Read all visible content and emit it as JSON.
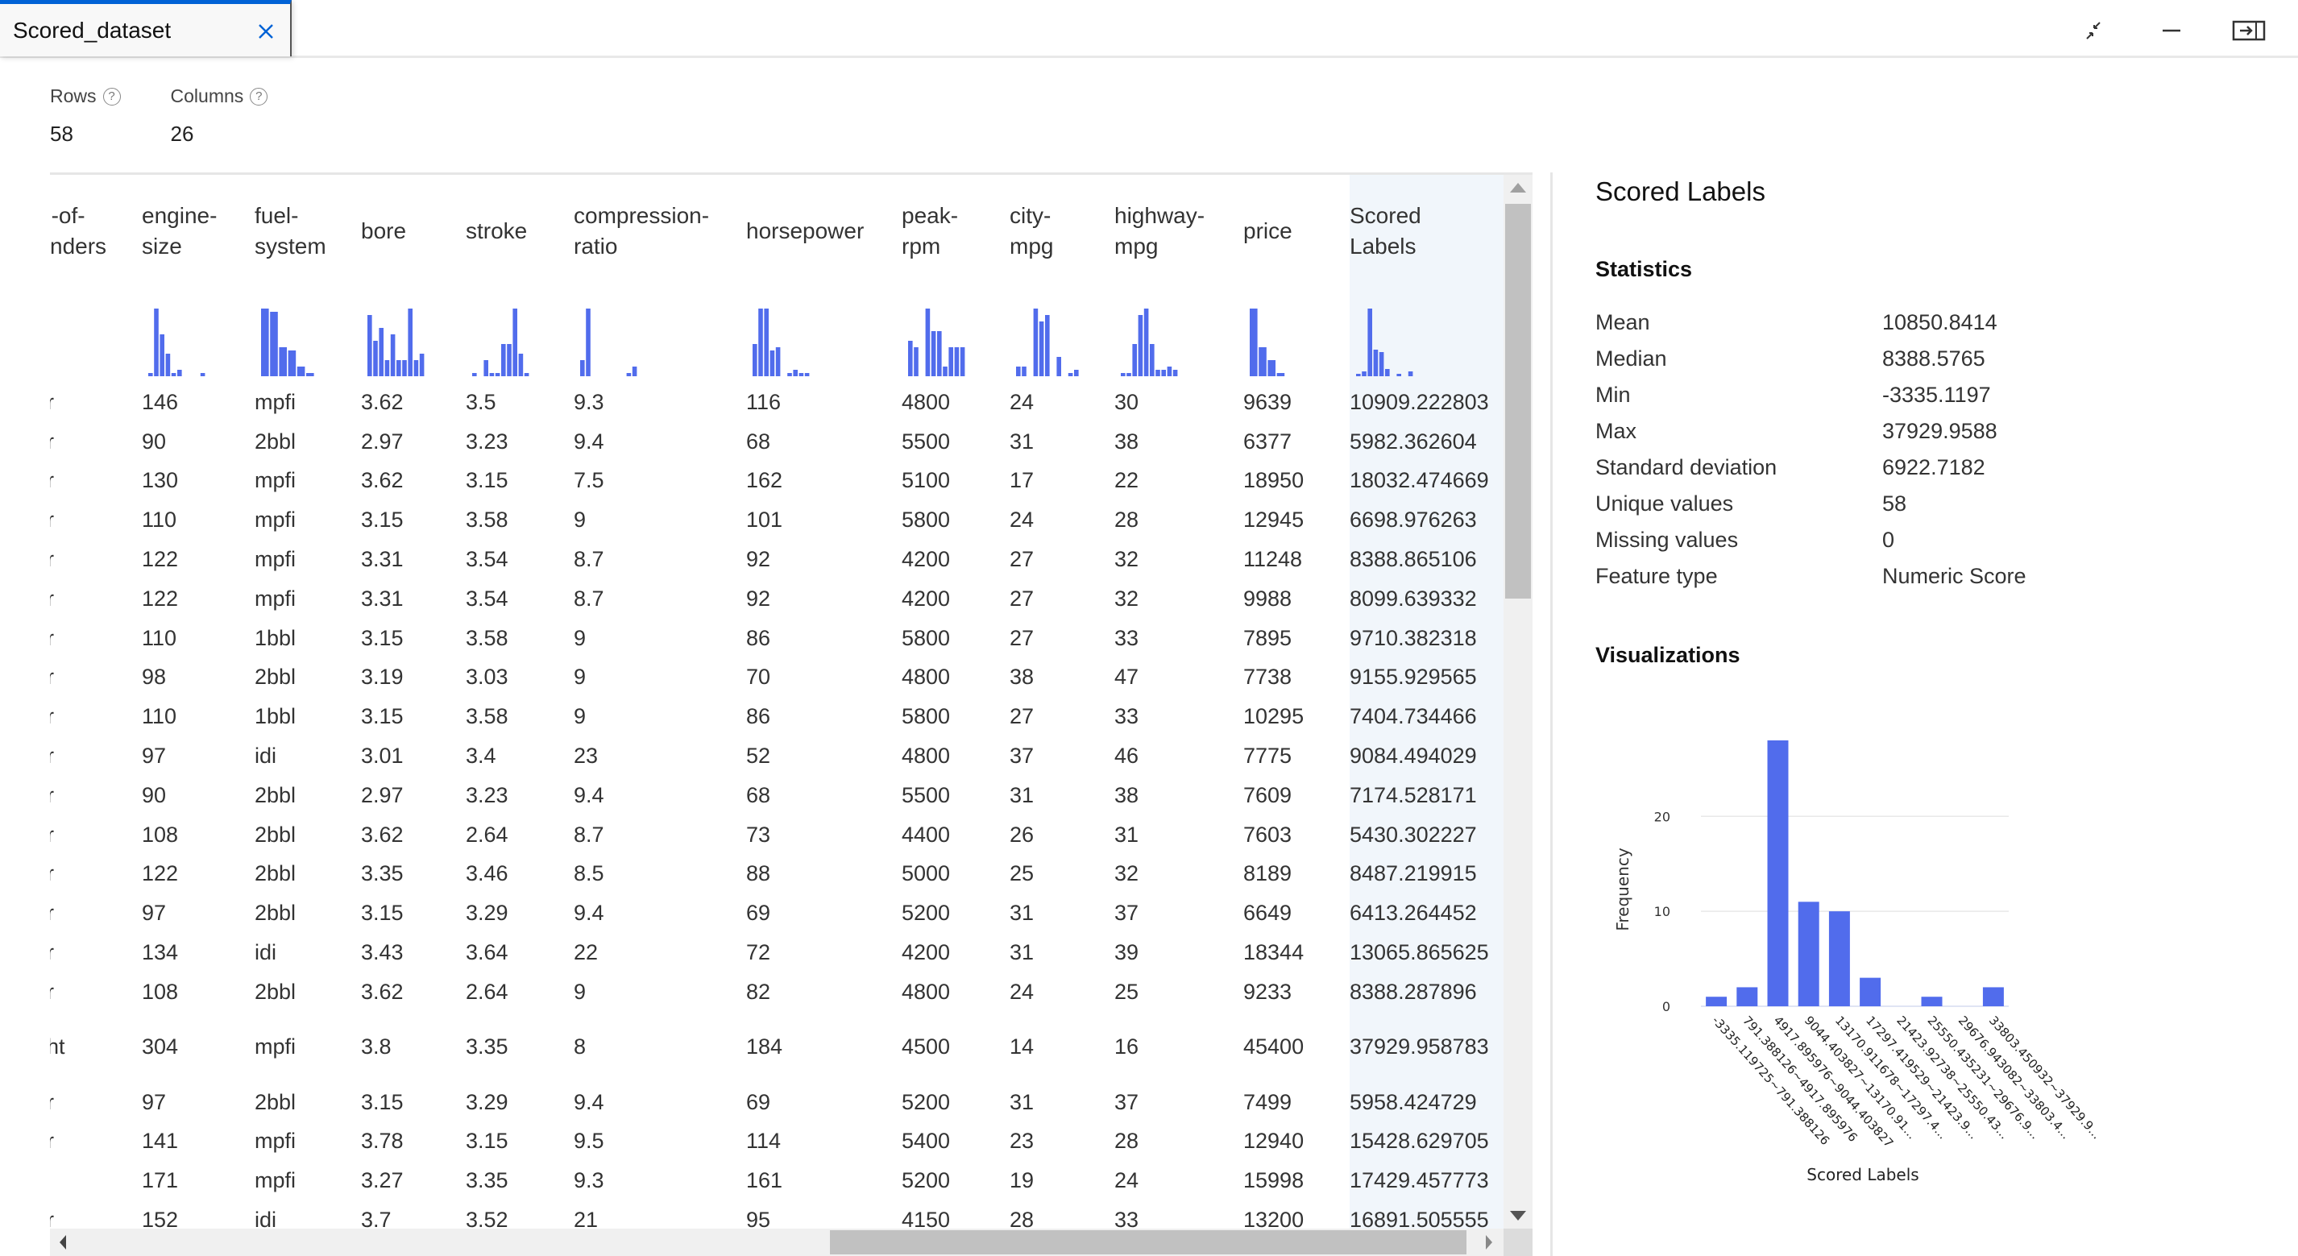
{
  "tab": {
    "title": "Scored_dataset",
    "close_icon": "close-icon"
  },
  "window_controls": [
    {
      "name": "collapse-icon"
    },
    {
      "name": "minimize-icon"
    },
    {
      "name": "dock-panel-icon"
    }
  ],
  "summary": {
    "rows_label": "Rows",
    "rows_value": "58",
    "columns_label": "Columns",
    "columns_value": "26",
    "help_glyph": "?"
  },
  "table": {
    "columns": [
      {
        "key": "cyl",
        "label": "n-of-\nnders",
        "partial": true
      },
      {
        "key": "engine_size",
        "label": "engine-\nsize"
      },
      {
        "key": "fuel_system",
        "label": "fuel-\nsystem"
      },
      {
        "key": "bore",
        "label": "bore"
      },
      {
        "key": "stroke",
        "label": "stroke"
      },
      {
        "key": "compression_ratio",
        "label": "compression-\nratio"
      },
      {
        "key": "horsepower",
        "label": "horsepower"
      },
      {
        "key": "peak_rpm",
        "label": "peak-\nrpm"
      },
      {
        "key": "city_mpg",
        "label": "city-\nmpg"
      },
      {
        "key": "highway_mpg",
        "label": "highway-\nmpg"
      },
      {
        "key": "price",
        "label": "price"
      },
      {
        "key": "scored_labels",
        "label": "Scored\nLabels",
        "selected": true
      }
    ],
    "column_histograms": {
      "cyl": [],
      "engine_size": [
        1,
        21,
        13,
        7,
        1,
        2,
        0,
        0,
        0,
        1
      ],
      "fuel_system": [
        21,
        20,
        9,
        8,
        3,
        1
      ],
      "bore": [
        19,
        11,
        15,
        5,
        13,
        5,
        5,
        21,
        5,
        7
      ],
      "stroke": [
        1,
        0,
        5,
        1,
        1,
        10,
        10,
        21,
        7,
        1
      ],
      "compression_ratio": [
        5,
        21,
        0,
        0,
        0,
        0,
        0,
        0,
        1,
        3
      ],
      "horsepower": [
        10,
        21,
        21,
        8,
        9,
        0,
        1,
        2,
        1,
        1
      ],
      "peak_rpm": [
        11,
        9,
        0,
        21,
        14,
        14,
        3,
        9,
        9,
        9
      ],
      "city_mpg": [
        3,
        3,
        0,
        21,
        17,
        19,
        0,
        6,
        0,
        1,
        2
      ],
      "highway_mpg": [
        1,
        1,
        10,
        19,
        21,
        10,
        2,
        2,
        3,
        2
      ],
      "price": [
        21,
        9,
        5,
        1
      ],
      "scored_labels": [
        1,
        2,
        28,
        11,
        10,
        3,
        0,
        1,
        0,
        2
      ]
    },
    "rows": [
      [
        "r",
        "146",
        "mpfi",
        "3.62",
        "3.5",
        "9.3",
        "116",
        "4800",
        "24",
        "30",
        "9639",
        "10909.222803"
      ],
      [
        "r",
        "90",
        "2bbl",
        "2.97",
        "3.23",
        "9.4",
        "68",
        "5500",
        "31",
        "38",
        "6377",
        "5982.362604"
      ],
      [
        "r",
        "130",
        "mpfi",
        "3.62",
        "3.15",
        "7.5",
        "162",
        "5100",
        "17",
        "22",
        "18950",
        "18032.474669"
      ],
      [
        "r",
        "110",
        "mpfi",
        "3.15",
        "3.58",
        "9",
        "101",
        "5800",
        "24",
        "28",
        "12945",
        "6698.976263"
      ],
      [
        "r",
        "122",
        "mpfi",
        "3.31",
        "3.54",
        "8.7",
        "92",
        "4200",
        "27",
        "32",
        "11248",
        "8388.865106"
      ],
      [
        "r",
        "122",
        "mpfi",
        "3.31",
        "3.54",
        "8.7",
        "92",
        "4200",
        "27",
        "32",
        "9988",
        "8099.639332"
      ],
      [
        "r",
        "110",
        "1bbl",
        "3.15",
        "3.58",
        "9",
        "86",
        "5800",
        "27",
        "33",
        "7895",
        "9710.382318"
      ],
      [
        "r",
        "98",
        "2bbl",
        "3.19",
        "3.03",
        "9",
        "70",
        "4800",
        "38",
        "47",
        "7738",
        "9155.929565"
      ],
      [
        "r",
        "110",
        "1bbl",
        "3.15",
        "3.58",
        "9",
        "86",
        "5800",
        "27",
        "33",
        "10295",
        "7404.734466"
      ],
      [
        "r",
        "97",
        "idi",
        "3.01",
        "3.4",
        "23",
        "52",
        "4800",
        "37",
        "46",
        "7775",
        "9084.494029"
      ],
      [
        "r",
        "90",
        "2bbl",
        "2.97",
        "3.23",
        "9.4",
        "68",
        "5500",
        "31",
        "38",
        "7609",
        "7174.528171"
      ],
      [
        "r",
        "108",
        "2bbl",
        "3.62",
        "2.64",
        "8.7",
        "73",
        "4400",
        "26",
        "31",
        "7603",
        "5430.302227"
      ],
      [
        "r",
        "122",
        "2bbl",
        "3.35",
        "3.46",
        "8.5",
        "88",
        "5000",
        "25",
        "32",
        "8189",
        "8487.219915"
      ],
      [
        "r",
        "97",
        "2bbl",
        "3.15",
        "3.29",
        "9.4",
        "69",
        "5200",
        "31",
        "37",
        "6649",
        "6413.264452"
      ],
      [
        "r",
        "134",
        "idi",
        "3.43",
        "3.64",
        "22",
        "72",
        "4200",
        "31",
        "39",
        "18344",
        "13065.865625"
      ],
      [
        "r",
        "108",
        "2bbl",
        "3.62",
        "2.64",
        "9",
        "82",
        "4800",
        "24",
        "25",
        "9233",
        "8388.287896"
      ],
      [
        "ht",
        "304",
        "mpfi",
        "3.8",
        "3.35",
        "8",
        "184",
        "4500",
        "14",
        "16",
        "45400",
        "37929.958783"
      ],
      [
        "r",
        "97",
        "2bbl",
        "3.15",
        "3.29",
        "9.4",
        "69",
        "5200",
        "31",
        "37",
        "7499",
        "5958.424729"
      ],
      [
        "r",
        "141",
        "mpfi",
        "3.78",
        "3.15",
        "9.5",
        "114",
        "5400",
        "23",
        "28",
        "12940",
        "15428.629705"
      ],
      [
        "",
        "171",
        "mpfi",
        "3.27",
        "3.35",
        "9.3",
        "161",
        "5200",
        "19",
        "24",
        "15998",
        "17429.457773"
      ],
      [
        "r",
        "152",
        "idi",
        "3.7",
        "3.52",
        "21",
        "95",
        "4150",
        "28",
        "33",
        "13200",
        "16891.505555"
      ]
    ],
    "tall_row_index": 16
  },
  "panel": {
    "title": "Scored Labels",
    "statistics_title": "Statistics",
    "statistics": [
      {
        "label": "Mean",
        "value": "10850.8414"
      },
      {
        "label": "Median",
        "value": "8388.5765"
      },
      {
        "label": "Min",
        "value": "-3335.1197"
      },
      {
        "label": "Max",
        "value": "37929.9588"
      },
      {
        "label": "Standard deviation",
        "value": "6922.7182"
      },
      {
        "label": "Unique values",
        "value": "58"
      },
      {
        "label": "Missing values",
        "value": "0"
      },
      {
        "label": "Feature type",
        "value": "Numeric Score"
      }
    ],
    "visualizations_title": "Visualizations"
  },
  "colors": {
    "bar": "#516cec",
    "accent": "#0062d6",
    "selected_column_bg": "#f1f6fb"
  },
  "chart_data": {
    "type": "bar",
    "title": "",
    "xlabel": "Scored Labels",
    "ylabel": "Frequency",
    "ylim": [
      0,
      28
    ],
    "yticks": [
      0,
      10,
      20
    ],
    "grid": true,
    "categories": [
      "-3335.119725~791.388126",
      "791.388126~4917.895976",
      "4917.895976~9044.403827",
      "9044.403827~13170.91...",
      "13170.911678~17297.4...",
      "17297.419529~21423.9...",
      "21423.92738~25550.43...",
      "25550.435231~29676.9...",
      "29676.943082~33803.4...",
      "33803.450932~37929.9..."
    ],
    "values": [
      1,
      2,
      28,
      11,
      10,
      3,
      0,
      1,
      0,
      2
    ]
  }
}
